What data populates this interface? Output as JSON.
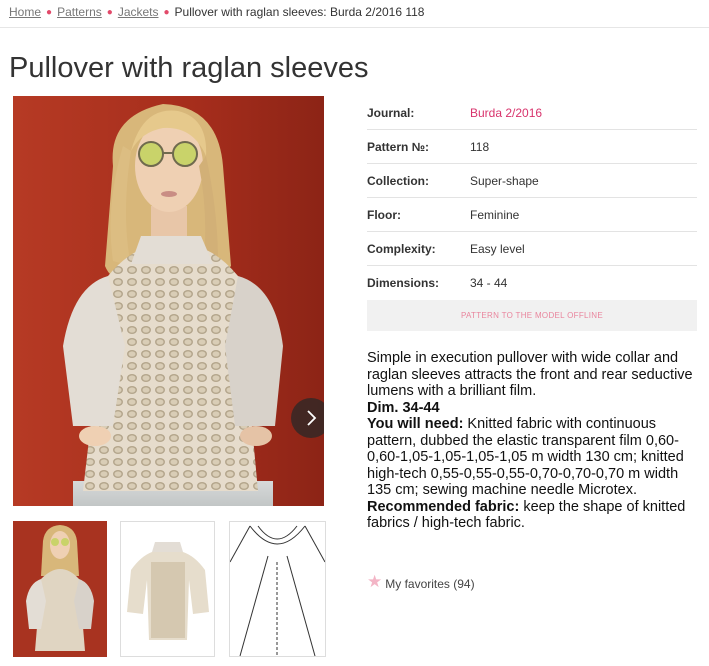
{
  "breadcrumb": {
    "items": [
      "Home",
      "Patterns",
      "Jackets"
    ],
    "current": "Pullover with raglan sleeves: Burda 2/2016 118"
  },
  "page_title": "Pullover with raglan sleeves",
  "details": [
    {
      "label": "Journal:",
      "value": "Burda 2/2016",
      "link": true
    },
    {
      "label": "Pattern №:",
      "value": "118",
      "link": false
    },
    {
      "label": "Collection:",
      "value": "Super-shape",
      "link": false
    },
    {
      "label": "Floor:",
      "value": "Feminine",
      "link": false
    },
    {
      "label": "Complexity:",
      "value": "Easy level",
      "link": false
    },
    {
      "label": "Dimensions:",
      "value": "34 - 44",
      "link": false
    }
  ],
  "offline_button": "PATTERN TO THE MODEL OFFLINE",
  "description": {
    "intro": "Simple in execution pullover with wide collar and raglan sleeves attracts the front and rear seductive lumens with a brilliant film.",
    "dim": "Dim. 34-44",
    "need_label": "You will need:",
    "need_text": " Knitted fabric with continuous pattern, dubbed the elastic transparent film 0,60-0,60-1,05-1,05-1,05-1,05 m width 130 cm; knitted high-tech 0,55-0,55-0,55-0,70-0,70-0,70 m width 135 cm; sewing machine needle Microtex.",
    "fabric_label": "Recommended fabric:",
    "fabric_text": " keep the shape of knitted fabrics / high-tech fabric."
  },
  "favorites": {
    "label": "My favorites (94)",
    "icon": "star-icon"
  },
  "colors": {
    "accent": "#d8336c",
    "background_photo": "#a83320"
  }
}
